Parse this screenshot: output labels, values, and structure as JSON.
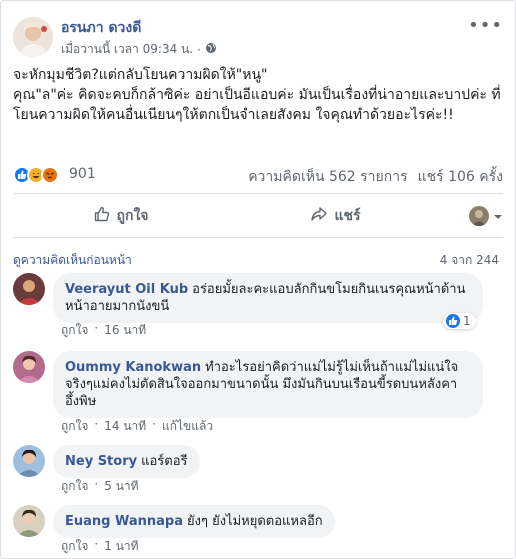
{
  "post": {
    "author": "อรนภา ดวงดี",
    "timestamp": "เมื่อวานนี้ เวลา 09:34 น.",
    "dot": "·",
    "more": "•••",
    "body_lines": [
      "จะหักมุมชีวิต?แต่กลับโยนความผิดให้\"หนู\"",
      "คุณ\"ล\"ค่ะ คิดจะคบก็กล้าซิค่ะ อย่าเป็นอีแอบค่ะ มันเป็นเรื่องที่น่าอายและบาปค่ะ ที่โยนความผิดให้คนอื่นเนียนๆให้ตกเป็นจำเลยสังคม ใจคุณทำด้วยอะไรค่ะ!!"
    ]
  },
  "reactions": {
    "count": "901",
    "comments_stat": "ความคิดเห็น 562 รายการ",
    "shares_stat": "แชร์ 106 ครั้ง"
  },
  "actions": {
    "like_label": "ถูกใจ",
    "share_label": "แชร์"
  },
  "comments_section": {
    "heading": "ดูความคิดเห็นก่อนหน้า",
    "counter": "4 จาก 244"
  },
  "comments": [
    {
      "name": "Veerayut Oil Kub",
      "text": "อร่อยมั้ยละคะแอบลักกินขโมยกินเนรคุณหน้าด้านหน้าอายมากนังขนี",
      "like_label": "ถูกใจ",
      "dot": "·",
      "time": "16 นาที",
      "likes": "1"
    },
    {
      "name": "Oummy Kanokwan",
      "text": "ทำอะไรอย่าคิดว่าแม่ไม่รู้ไม่เห็นถ้าแม่ไม่แน่ใจจริงๆแม่คงไม่ตัดสินใจออกมาขนาดนั้น มึงมันกินบนเรือนขี้รดบนหลังคา อึ้งพิษ",
      "like_label": "ถูกใจ",
      "dot": "·",
      "time": "14 นาที",
      "edited": "แก้ไขแล้ว"
    },
    {
      "name": "Ney Story",
      "text": "แอร์ตอรี",
      "like_label": "ถูกใจ",
      "dot": "·",
      "time": "5 นาที"
    },
    {
      "name": "Euang Wannapa",
      "text": "ยังๆ ยังไม่หยุดตอแหลอีก",
      "like_label": "ถูกใจ",
      "dot": "·",
      "time": "1 นาที"
    }
  ],
  "colors": {
    "link": "#385898",
    "like_blue": "#1877f2",
    "haha_yellow": "#f7b125",
    "angry_orange": "#e9710f",
    "bubble_bg": "#f2f3f5"
  }
}
